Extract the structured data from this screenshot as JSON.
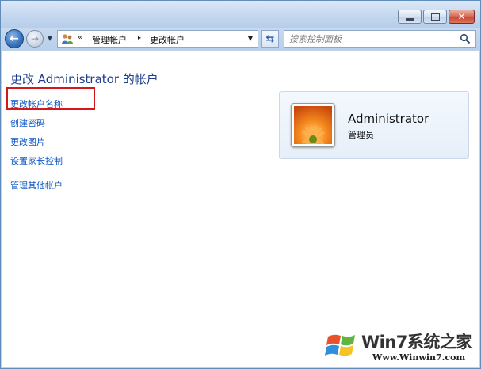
{
  "window": {
    "buttons": {
      "minimize": "minimize",
      "maximize": "maximize",
      "close": "✕"
    }
  },
  "navigation": {
    "breadcrumb_overflow": "«",
    "breadcrumbs": [
      "管理帐户",
      "更改帐户"
    ],
    "separator": "▸",
    "search_placeholder": "搜索控制面板"
  },
  "main": {
    "title": "更改 Administrator 的帐户",
    "tasks": [
      "更改帐户名称",
      "创建密码",
      "更改图片",
      "设置家长控制"
    ],
    "secondary_task": "管理其他帐户",
    "highlighted_task_index": 0
  },
  "account": {
    "name": "Administrator",
    "role": "管理员"
  },
  "watermark": {
    "logo_text": "Win7系统之家",
    "url": "Www.Winwin7.com"
  },
  "colors": {
    "link": "#0d57c4",
    "title": "#1e3c8c",
    "highlight_box": "#d5171c",
    "titlebar": "#c2d6ee"
  },
  "icons": {
    "address": "user-accounts-icon",
    "refresh": "refresh-icon",
    "search": "search-icon",
    "back": "back-arrow-icon",
    "forward": "forward-arrow-icon"
  }
}
